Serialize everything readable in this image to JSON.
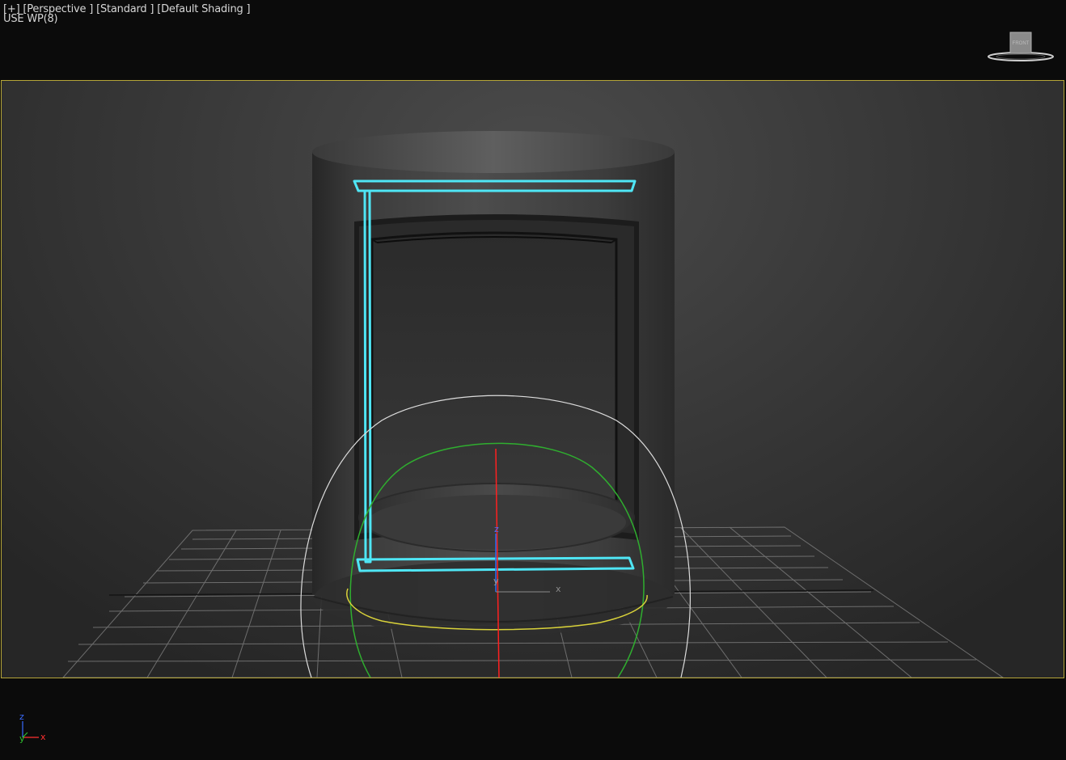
{
  "viewport": {
    "label_line1": "[+] [Perspective ] [Standard ] [Default Shading ]",
    "label_line2": "USE WP(8)",
    "active_border_color": "#b5a538"
  },
  "viewcube": {
    "face_label": "FRONT"
  },
  "gizmo": {
    "axis_z": "z",
    "axis_y": "y",
    "axis_x": "x"
  },
  "triad": {
    "axis_z": "z",
    "axis_y": "y",
    "axis_x": "x"
  },
  "colors": {
    "selection_outline": "#4fe6f5",
    "gizmo_z": "#ff2020",
    "gizmo_y": "#2fbf2f",
    "gizmo_x": "#e0e040"
  }
}
